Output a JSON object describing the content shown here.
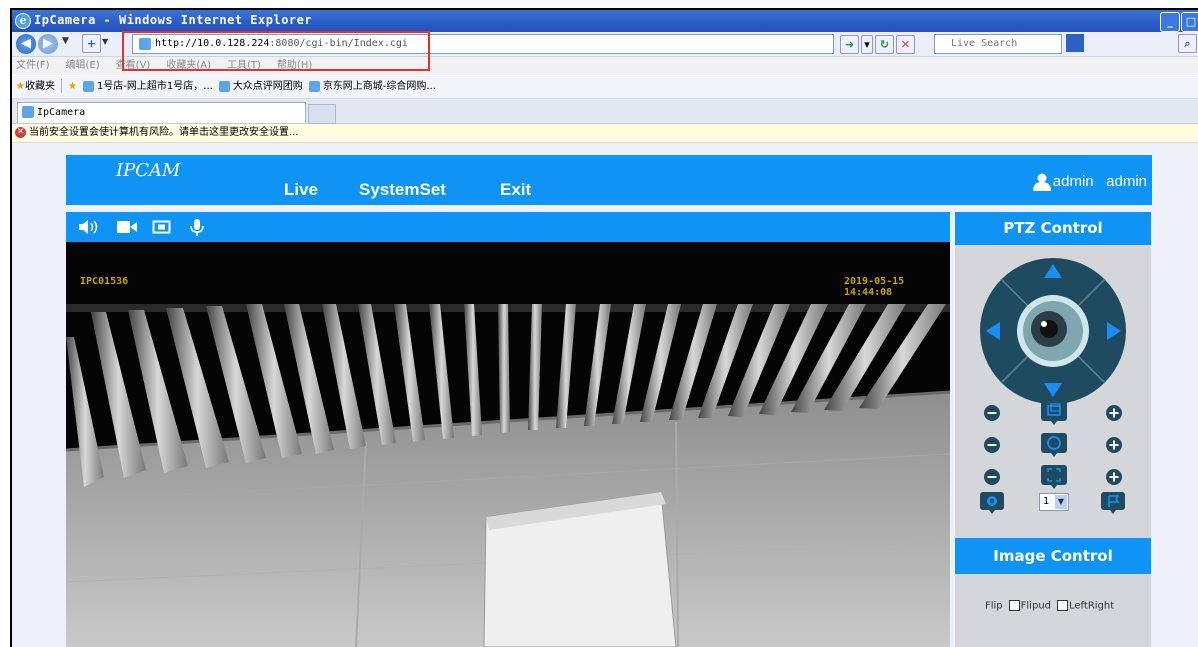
{
  "browser": {
    "title": "IpCamera - Windows Internet Explorer",
    "url_host": "http://10.0.128.224",
    "url_rest": ":8080/cgi-bin/Index.cgi",
    "search_placeholder": "Live Search",
    "menu": [
      "文件(F)",
      "编辑(E)",
      "查看(V)",
      "收藏夹(A)",
      "工具(T)",
      "帮助(H)"
    ],
    "favorites_label": "收藏夹",
    "favorites": [
      "1号店-网上超市1号店，...",
      "大众点评网团购",
      "京东网上商城-综合网购..."
    ],
    "tab_title": "IpCamera",
    "security_warning": "当前安全设置会使计算机有风险。请单击这里更改安全设置..."
  },
  "app": {
    "logo": "IPCAM",
    "nav": [
      "Live",
      "SystemSet",
      "Exit"
    ],
    "user_label": "admin",
    "user_name": "admin",
    "osd_left": "IPC01536",
    "osd_right": "2019-05-15 14:44:08",
    "ptz_title": "PTZ Control",
    "preset_value": "1",
    "image_title": "Image Control",
    "flip_label": "Flip",
    "flipud_label": "Flipud",
    "leftright_label": "LeftRight"
  },
  "colors": {
    "accent": "#0f93f4",
    "panel": "#d4d6da",
    "highlight_box": "#e03232"
  }
}
